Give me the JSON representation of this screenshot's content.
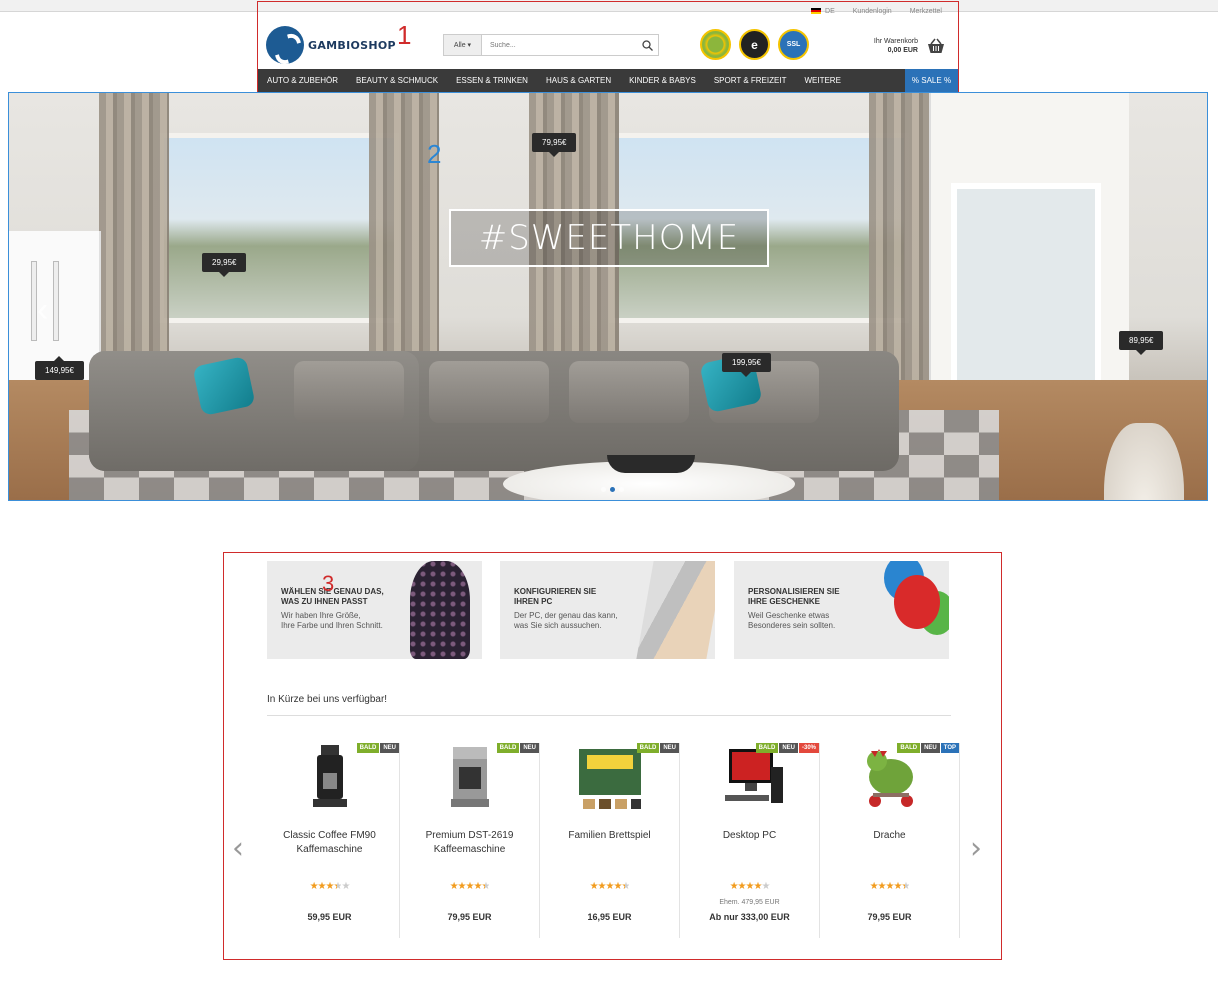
{
  "top_links": {
    "language": "DE",
    "login": "Kundenlogin",
    "wishlist": "Merkzettel"
  },
  "logo": {
    "text": "GAMBIOSHOP"
  },
  "markers": {
    "header": "1",
    "hero": "2",
    "section": "3"
  },
  "search": {
    "category": "Alle",
    "placeholder": "Suche..."
  },
  "badges": {
    "ssl": "SSL",
    "trusted": "e"
  },
  "cart": {
    "label": "Ihr Warenkorb",
    "sum": "0,00 EUR"
  },
  "nav": {
    "items": [
      "AUTO & ZUBEHÖR",
      "BEAUTY & SCHMUCK",
      "ESSEN & TRINKEN",
      "HAUS & GARTEN",
      "KINDER & BABYS",
      "SPORT & FREIZEIT",
      "WEITERE"
    ],
    "sale": "% SALE %"
  },
  "hero": {
    "title": "#SWEETHOME",
    "prices": [
      "79,95€",
      "29,95€",
      "149,95€",
      "199,95€",
      "89,95€"
    ]
  },
  "teasers": [
    {
      "title": "WÄHLEN SIE GENAU DAS,\nWAS ZU IHNEN PASST",
      "text": "Wir haben Ihre Größe,\nIhre Farbe und Ihren Schnitt."
    },
    {
      "title": "KONFIGURIEREN SIE\nIHREN PC",
      "text": "Der PC, der genau das kann,\nwas Sie sich aussuchen."
    },
    {
      "title": "PERSONALISIEREN SIE\nIHRE GESCHENKE",
      "text": "Weil Geschenke etwas\nBesonderes sein sollten."
    }
  ],
  "section": {
    "heading": "In Kürze bei uns verfügbar!"
  },
  "products": [
    {
      "name": "Classic Coffee FM90\nKaffemaschine",
      "labels": [
        "BALD",
        "NEU"
      ],
      "rating": 3.5,
      "old_price": "",
      "price": "59,95 EUR"
    },
    {
      "name": "Premium DST-2619\nKaffeemaschine",
      "labels": [
        "BALD",
        "NEU"
      ],
      "rating": 4.5,
      "old_price": "",
      "price": "79,95 EUR"
    },
    {
      "name": "Familien Brettspiel",
      "labels": [
        "BALD",
        "NEU"
      ],
      "rating": 4.5,
      "old_price": "",
      "price": "16,95 EUR"
    },
    {
      "name": "Desktop PC",
      "labels": [
        "BALD",
        "NEU",
        "-30%"
      ],
      "rating": 4,
      "old_price": "Ehem. 479,95 EUR",
      "price": "Ab nur 333,00 EUR"
    },
    {
      "name": "Drache",
      "labels": [
        "BALD",
        "NEU",
        "TOP"
      ],
      "rating": 4.5,
      "old_price": "",
      "price": "79,95 EUR"
    }
  ],
  "colors": {
    "nav_bg": "#3a3a3a",
    "accent_blue": "#2b72b8",
    "label_green": "#7fae2b",
    "star": "#f29c1f"
  }
}
